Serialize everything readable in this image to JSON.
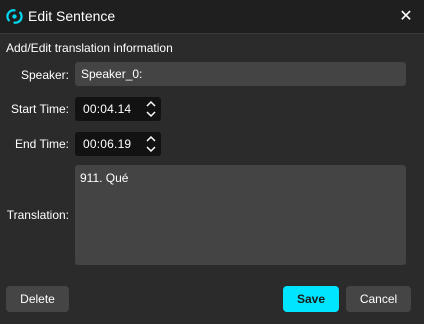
{
  "window": {
    "title": "Edit Sentence",
    "close_symbol": "✕",
    "app_icon": "logo-icon",
    "close_icon": "close-icon"
  },
  "form": {
    "heading": "Add/Edit translation information",
    "speaker": {
      "label": "Speaker:",
      "value": "Speaker_0:"
    },
    "start_time": {
      "label": "Start Time:",
      "value": "00:04.14"
    },
    "end_time": {
      "label": "End Time:",
      "value": "00:06.19"
    },
    "translation": {
      "label": "Translation:",
      "value": "911. Qué"
    }
  },
  "buttons": {
    "delete": "Delete",
    "save": "Save",
    "cancel": "Cancel"
  },
  "colors": {
    "accent": "#00e5ff",
    "background": "#2b2b2b",
    "titlebar": "#1f1f1f",
    "field": "#444444",
    "time_field": "#121212",
    "button": "#454545"
  }
}
